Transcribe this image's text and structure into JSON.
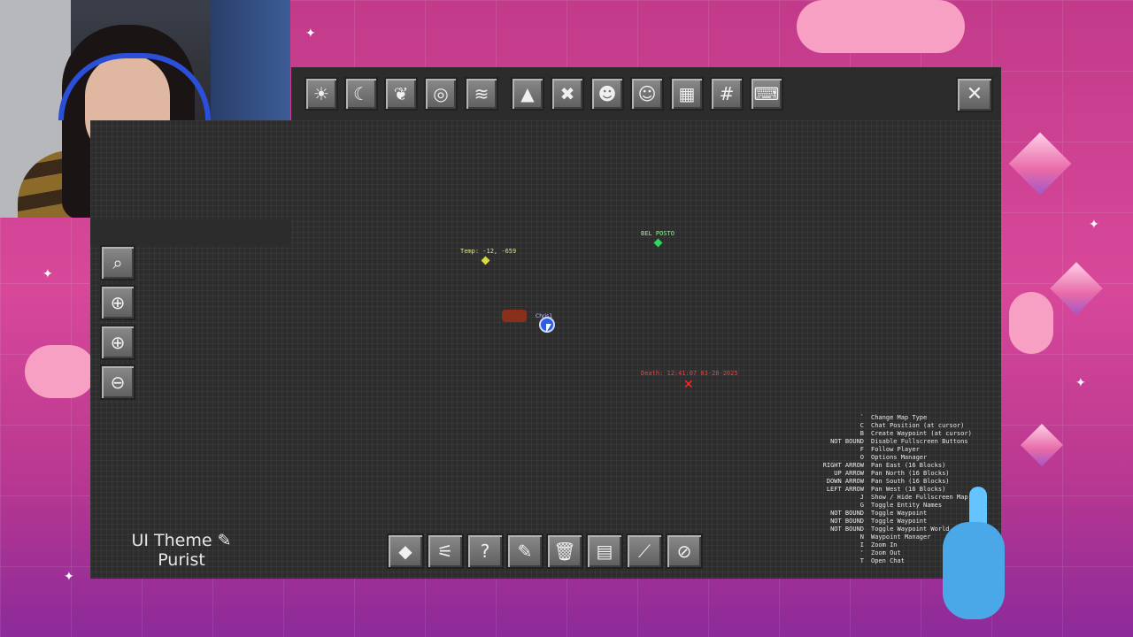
{
  "toolbar_top": {
    "buttons": [
      {
        "name": "day-mode-button",
        "icon": "sun-icon",
        "glyph": "☀"
      },
      {
        "name": "night-mode-button",
        "icon": "moon-icon",
        "glyph": "☾"
      },
      {
        "name": "biome-mode-button",
        "icon": "leaf-icon",
        "glyph": "❦"
      },
      {
        "name": "topography-mode-button",
        "icon": "contour-icon",
        "glyph": "◎"
      },
      {
        "name": "layers-mode-button",
        "icon": "layers-icon",
        "glyph": "≋"
      },
      {
        "name": "caves-mode-button",
        "icon": "cave-icon",
        "glyph": "▲"
      },
      {
        "name": "grid-toggle-button",
        "icon": "crosshatch-icon",
        "glyph": "✖"
      },
      {
        "name": "hostile-mobs-button",
        "icon": "alien-head-icon",
        "glyph": "☻"
      },
      {
        "name": "passive-mobs-button",
        "icon": "cat-icon",
        "glyph": "☺"
      },
      {
        "name": "waypoint-beacon-button",
        "icon": "beacon-icon",
        "glyph": "▦"
      },
      {
        "name": "chunk-grid-button",
        "icon": "grid-icon",
        "glyph": "#"
      },
      {
        "name": "keyboard-button",
        "icon": "keyboard-icon",
        "glyph": "⌨"
      }
    ],
    "close": {
      "icon": "close-icon",
      "glyph": "✕"
    }
  },
  "sidebar": [
    {
      "name": "search-button",
      "icon": "search-icon",
      "glyph": "⌕"
    },
    {
      "name": "center-on-player-button",
      "icon": "crosshair-icon",
      "glyph": "⊕"
    },
    {
      "name": "zoom-in-button",
      "icon": "zoom-in-icon",
      "glyph": "⊕"
    },
    {
      "name": "zoom-out-button",
      "icon": "zoom-out-icon",
      "glyph": "⊖"
    }
  ],
  "map": {
    "waypoints": [
      {
        "label": "Temp: -12, -659",
        "color": "#e8e860",
        "dot_color": "#d8d84a"
      },
      {
        "label": "BEL POSTO",
        "color": "#7dff7d",
        "dot_color": "#2bd85a"
      },
      {
        "label": "Death: 12:41:07 03-28-2025",
        "color": "#ff3a3a",
        "dot_color": "#ff2a2a"
      }
    ],
    "player_label": "Chris1"
  },
  "keybinds": [
    {
      "key": "`",
      "action": "Change Map Type"
    },
    {
      "key": "C",
      "action": "Chat Position (at cursor)"
    },
    {
      "key": "B",
      "action": "Create Waypoint (at cursor)"
    },
    {
      "key": "NOT BOUND",
      "action": "Disable Fullscreen Buttons"
    },
    {
      "key": "F",
      "action": "Follow Player"
    },
    {
      "key": "O",
      "action": "Options Manager"
    },
    {
      "key": "RIGHT ARROW",
      "action": "Pan East (16 Blocks)"
    },
    {
      "key": "UP ARROW",
      "action": "Pan North (16 Blocks)"
    },
    {
      "key": "DOWN ARROW",
      "action": "Pan South (16 Blocks)"
    },
    {
      "key": "LEFT ARROW",
      "action": "Pan West (16 Blocks)"
    },
    {
      "key": "J",
      "action": "Show / Hide Fullscreen Map"
    },
    {
      "key": "G",
      "action": "Toggle Entity Names"
    },
    {
      "key": "NOT BOUND",
      "action": "Toggle Waypoint"
    },
    {
      "key": "NOT BOUND",
      "action": "Toggle Waypoint"
    },
    {
      "key": "NOT BOUND",
      "action": "Toggle Waypoint World"
    },
    {
      "key": "N",
      "action": "Waypoint Manager"
    },
    {
      "key": "I",
      "action": "Zoom In"
    },
    {
      "key": "'",
      "action": "Zoom Out"
    },
    {
      "key": "T",
      "action": "Open Chat"
    }
  ],
  "theme": {
    "line1": "UI Theme ✎",
    "line2": "Purist"
  },
  "toolbar_bottom": [
    {
      "name": "waypoint-button",
      "icon": "waypoint-diamond-icon",
      "glyph": "◆"
    },
    {
      "name": "settings-sliders-button",
      "icon": "sliders-icon",
      "glyph": "⚟"
    },
    {
      "name": "help-button",
      "icon": "question-icon",
      "glyph": "?"
    },
    {
      "name": "theme-button",
      "icon": "palette-icon",
      "glyph": "✎"
    },
    {
      "name": "delete-button",
      "icon": "trash-icon",
      "glyph": "🗑"
    },
    {
      "name": "export-button",
      "icon": "document-icon",
      "glyph": "▤"
    },
    {
      "name": "edit-tool-button",
      "icon": "wand-icon",
      "glyph": "⟋"
    },
    {
      "name": "disable-button",
      "icon": "no-entry-icon",
      "glyph": "⊘"
    }
  ]
}
